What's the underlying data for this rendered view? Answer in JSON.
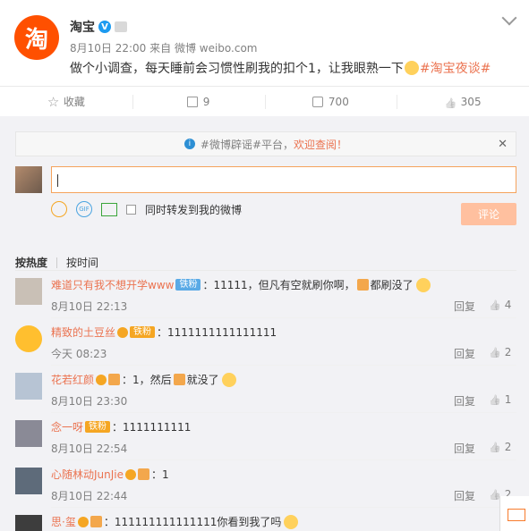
{
  "post": {
    "author": "淘宝",
    "time": "8月10日 22:00",
    "source": "来自 微博 weibo.com",
    "text": "做个小调查，每天睡前会习惯性刷我的扣个1，让我眼熟一下",
    "hashtag": "#淘宝夜谈#"
  },
  "actions": {
    "favorite": "收藏",
    "forward": "9",
    "comment": "700",
    "like": "305"
  },
  "notice": {
    "text": "#微博辟谣#平台，",
    "link": "欢迎查阅！"
  },
  "composer": {
    "sync_label": "同时转发到我的微博",
    "submit": "评论"
  },
  "sort": {
    "hot": "按热度",
    "time": "按时间"
  },
  "comments": [
    {
      "name": "难道只有我不想开学www",
      "badge": "铁粉",
      "text": "：11111，但凡有空就刷你啊，",
      "text2": "都刷没了",
      "time": "8月10日 22:13",
      "reply": "回复",
      "likes": "4"
    },
    {
      "name": "精致的土豆丝",
      "badge": "铁粉",
      "text": "：1111111111111111",
      "text2": "",
      "time": "今天 08:23",
      "reply": "回复",
      "likes": "2"
    },
    {
      "name": "花若红颜",
      "badge": "",
      "text": "：1，然后",
      "text2": "就没了",
      "time": "8月10日 23:30",
      "reply": "回复",
      "likes": "1"
    },
    {
      "name": "念一呀",
      "badge": "铁粉",
      "text": "：1111111111",
      "text2": "",
      "time": "8月10日 22:54",
      "reply": "回复",
      "likes": "2"
    },
    {
      "name": "心随林动JunJie",
      "badge": "",
      "text": "：1",
      "text2": "",
      "time": "8月10日 22:44",
      "reply": "回复",
      "likes": "2"
    },
    {
      "name": "思·玺",
      "badge": "",
      "text": "：111111111111111你看到我了吗",
      "text2": "",
      "time": "",
      "reply": "",
      "likes": ""
    }
  ]
}
